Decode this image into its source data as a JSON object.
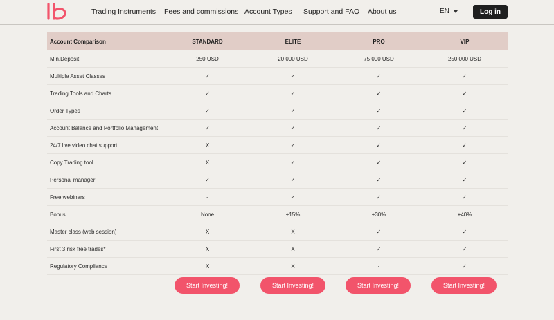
{
  "header": {
    "logo_alt": "lb",
    "nav": [
      {
        "label": "Trading Instruments"
      },
      {
        "label": "Fees and commissions"
      },
      {
        "label": "Account Types"
      },
      {
        "label": "Support and FAQ"
      },
      {
        "label": "About us"
      }
    ],
    "language": "EN",
    "login_label": "Log in"
  },
  "colors": {
    "accent": "#f2546b",
    "header_row": "#e1cdc7",
    "page_bg": "#f1efeb",
    "dark_button": "#1f1f1f"
  },
  "table": {
    "headers": [
      "Account Comparison",
      "STANDARD",
      "ELITE",
      "PRO",
      "VIP"
    ],
    "rows": [
      [
        "Min.Deposit",
        "250 USD",
        "20 000 USD",
        "75 000 USD",
        "250 000 USD"
      ],
      [
        "Multiple Asset Classes",
        "✓",
        "✓",
        "✓",
        "✓"
      ],
      [
        "Trading Tools and Charts",
        "✓",
        "✓",
        "✓",
        "✓"
      ],
      [
        "Order Types",
        "✓",
        "✓",
        "✓",
        "✓"
      ],
      [
        "Account Balance and Portfolio Management",
        "✓",
        "✓",
        "✓",
        "✓"
      ],
      [
        "24/7 live video chat support",
        "X",
        "✓",
        "✓",
        "✓"
      ],
      [
        "Copy Trading tool",
        "X",
        "✓",
        "✓",
        "✓"
      ],
      [
        "Personal manager",
        "✓",
        "✓",
        "✓",
        "✓"
      ],
      [
        "Free webinars",
        "-",
        "✓",
        "✓",
        "✓"
      ],
      [
        "Bonus",
        "None",
        "+15%",
        "+30%",
        "+40%"
      ],
      [
        "Master class (web session)",
        "X",
        "X",
        "✓",
        "✓"
      ],
      [
        "First 3 risk free trades*",
        "X",
        "X",
        "✓",
        "✓"
      ],
      [
        "Regulatory Compliance",
        "X",
        "X",
        "-",
        "✓"
      ]
    ]
  },
  "cta_label": "Start Investing!"
}
